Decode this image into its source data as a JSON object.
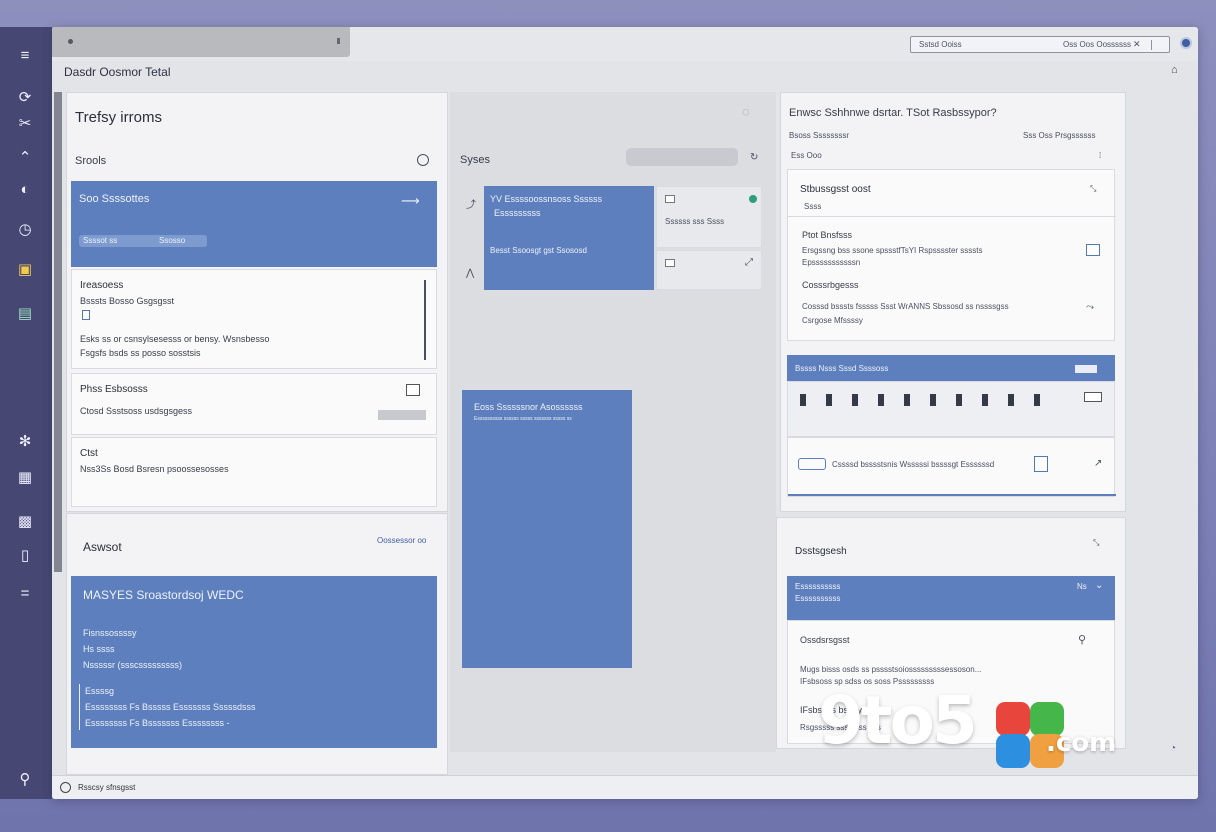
{
  "app": {
    "title": "Dasdr Oosmor Tetal",
    "search_placeholder": "Sstsd Ooiss",
    "search_hint": "Oss Oos Oossssss",
    "status_text": "Rsscsy sfnsgsst"
  },
  "column1": {
    "title": "Trefsy irroms",
    "search_label": "Srools",
    "selected_item": {
      "title": "Soo Ssssottes",
      "chip1": "Ssssot ss",
      "chip2": "Ssosso"
    },
    "items": [
      {
        "title": "Ireasoess",
        "subtitle": "Bsssts Bosso Gsgsgsst",
        "line1": "Esks ss or csnsylsesesss or bensy. Wsnsbesso",
        "line2": "Fsgsfs bsds ss posso sosstsis"
      },
      {
        "title": "Phss Esbsosss",
        "subtitle": "Ctosd Ssstsoss usdsgsgess"
      },
      {
        "title": "Ctst",
        "subtitle": "Nss3Ss Bosd Bsresn psoossesosses"
      }
    ],
    "account": {
      "title": "Aswsot",
      "link": "Oossessor oo",
      "banner": "MASYES Sroastordsoj WEDC",
      "lines": [
        "Fisnssossssy",
        "Hs ssss",
        "Nsssssr (ssscsssssssss)",
        "Essssg",
        "Essssssss Fs Bsssss Esssssss Sssssdsss",
        "Essssssss Fs Bsssssss Essssssss -"
      ]
    }
  },
  "column2": {
    "search_label": "Syses",
    "card1": {
      "title": "YV Essssoossnsoss Ssssss",
      "subtitle": "Esssssssss",
      "footer": "Besst Ssoosgt gst Ssososd"
    },
    "side_item1": "Ssssss sss Ssss",
    "card2": {
      "title": "Eoss Ssssssnor Asossssss",
      "subtitle": "Essssssssss ssssss sssss sssssss sssss ss"
    }
  },
  "column3": {
    "title": "Enwsc Sshhnwe dsrtar. TSot Rasbssypor?",
    "meta_left": "Bsoss Ssssssssr",
    "meta_right": "Sss Oss Prsgssssss",
    "meta_sub": "Ess Ooo",
    "section_title": "Stbussgsst oost",
    "section_sub": "Ssss",
    "entries": [
      {
        "title": "Ptot Bnsfsss",
        "line1": "Ersgssng bss ssone spssstfTsYI Rspsssster ssssts",
        "line2": "Epsssssssssssn"
      },
      {
        "title": "Cosssrbgesss",
        "line1": "Cosssd bsssts fsssss Ssst WrANNS Sbssosd ss nssssgss",
        "line2": "Csrgose Mfssssy"
      }
    ],
    "table_header": "Bssss Nsss Sssd Ssssoss",
    "table_note": "Cssssd bsssstsnis Wsssssi bssssgt Essssssd",
    "lower_title": "Dsstsgsesh",
    "lower_selected": {
      "title": "Essssssssss",
      "sub": "Essssssssss",
      "badge": "Ns"
    },
    "lower_items": [
      {
        "title": "Ossdsrsgsst",
        "line1": "Mugs bisss osds ss psssstsoiosssssssssessoson..."
      },
      {
        "title": "IFsbsoss bsdsy",
        "line1": "IFsbsoss sp sdss os soss Psssssssss"
      },
      {
        "title": "Rsgsssss sss ssss sss",
        "line1": "Rsgssssss ss sssssssssss"
      }
    ]
  },
  "watermark": {
    "brand": "9to5",
    "suffix": ".com"
  }
}
